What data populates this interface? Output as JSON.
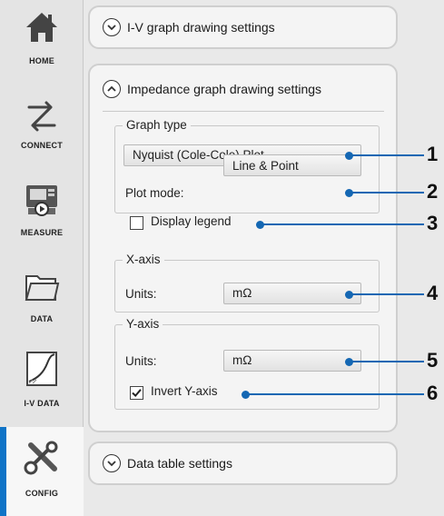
{
  "sidebar": {
    "items": [
      {
        "label": "HOME",
        "icon": "home-icon"
      },
      {
        "label": "CONNECT",
        "icon": "connect-icon"
      },
      {
        "label": "MEASURE",
        "icon": "measure-icon"
      },
      {
        "label": "DATA",
        "icon": "folder-icon"
      },
      {
        "label": "I-V DATA",
        "icon": "iv-data-icon"
      },
      {
        "label": "CONFIG",
        "icon": "config-icon",
        "active": true
      }
    ]
  },
  "sections": {
    "iv": {
      "title": "I-V graph drawing settings",
      "expanded": false
    },
    "impedance": {
      "title": "Impedance graph drawing settings",
      "expanded": true
    },
    "datatable": {
      "title": "Data table settings",
      "expanded": false
    }
  },
  "graph_type": {
    "title": "Graph type",
    "value": "Nyquist (Cole-Cole) Plot",
    "plot_mode_label": "Plot mode:",
    "plot_mode_value": "Line & Point",
    "legend_label": "Display legend",
    "legend_checked": false
  },
  "x_axis": {
    "title": "X-axis",
    "units_label": "Units:",
    "units_value": "mΩ"
  },
  "y_axis": {
    "title": "Y-axis",
    "units_label": "Units:",
    "units_value": "mΩ",
    "invert_label": "Invert Y-axis",
    "invert_checked": true
  },
  "callouts": [
    "1",
    "2",
    "3",
    "4",
    "5",
    "6"
  ],
  "colors": {
    "accent": "#0f74c7",
    "callout": "#1467b3"
  }
}
